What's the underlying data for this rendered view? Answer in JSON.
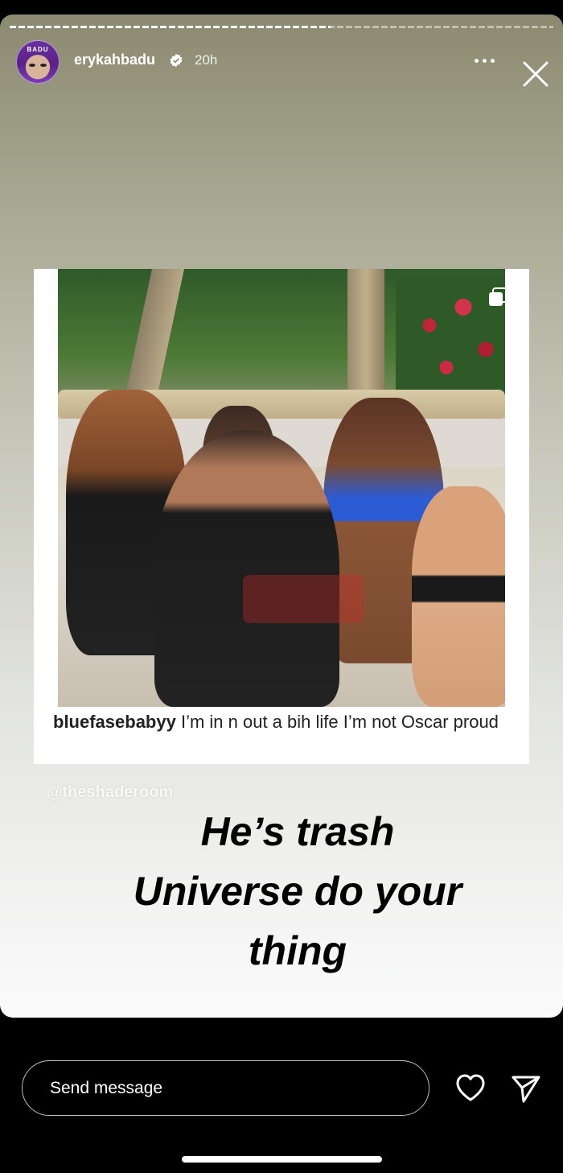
{
  "story": {
    "progress_fraction": 0.59,
    "user": {
      "username": "erykahbadu",
      "verified": true,
      "time_ago": "20h",
      "avatar_hat_text": "BADU"
    },
    "post": {
      "caption_handle": "bluefasebabyy",
      "caption_text": " I’m in n out a bih life I’m not Oscar proud"
    },
    "source_tag": "@theshaderoom",
    "overlay_text": [
      "He’s trash",
      "Universe do your",
      "thing"
    ]
  },
  "bottom_bar": {
    "message_placeholder": "Send message"
  },
  "icons": [
    "verified-badge-icon",
    "more-icon",
    "close-icon",
    "copy-icon",
    "heart-icon",
    "send-icon"
  ],
  "colors": {
    "background": "#000000",
    "text": "#ffffff",
    "verified": "#ffffff"
  }
}
